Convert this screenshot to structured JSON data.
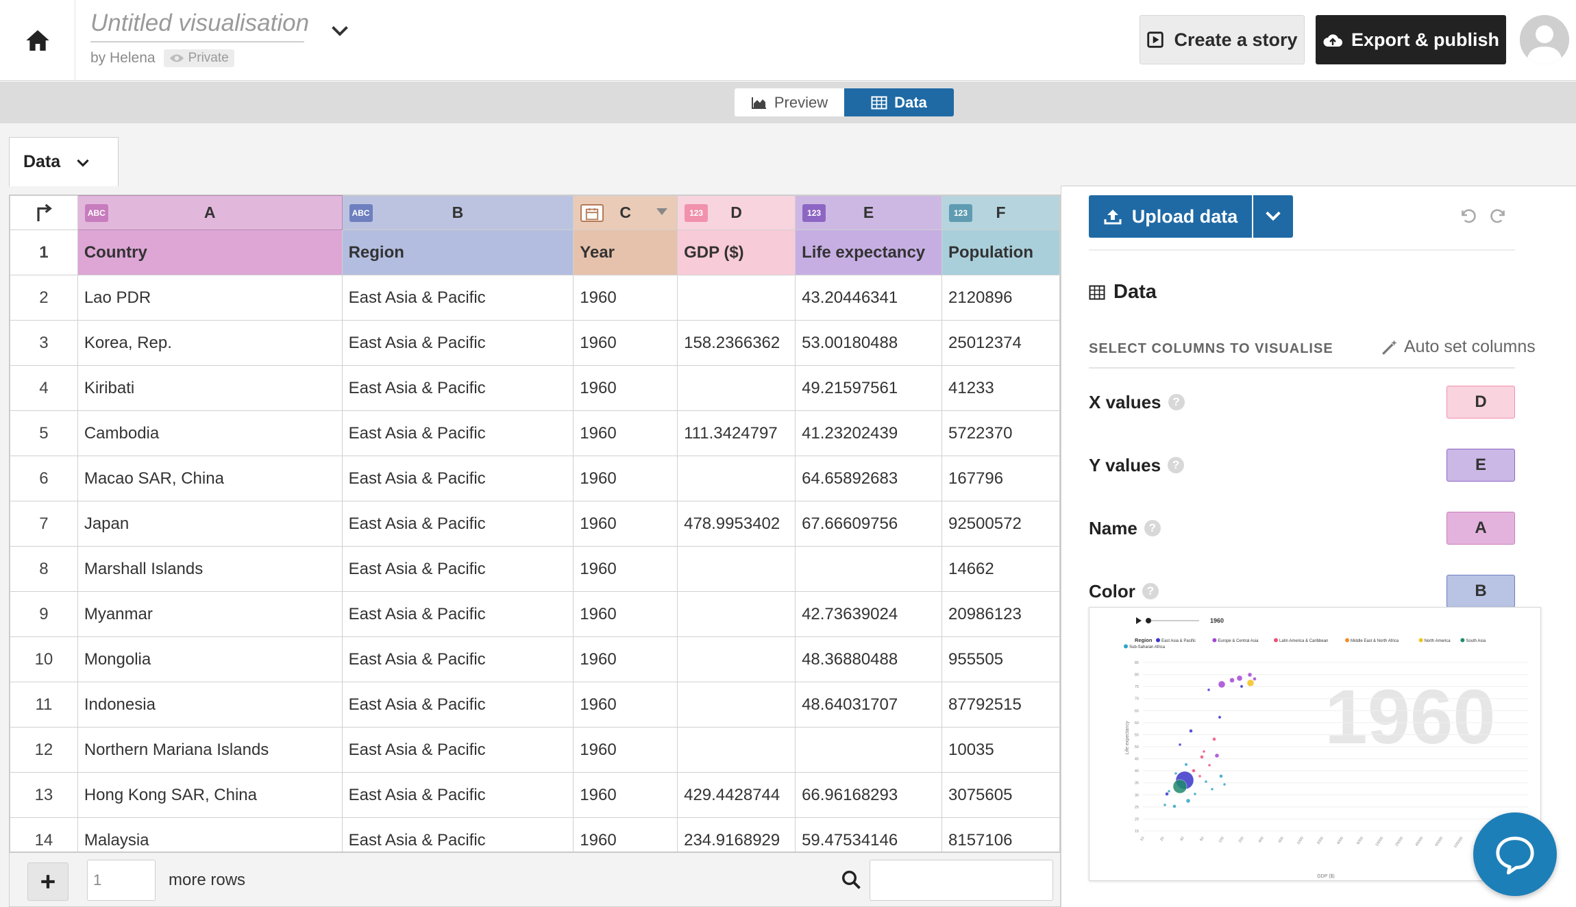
{
  "header": {
    "title": "Untitled visualisation",
    "byline": "by Helena",
    "privacy": "Private",
    "create_story": "Create a story",
    "export_publish": "Export & publish"
  },
  "view_toggle": {
    "preview": "Preview",
    "data": "Data"
  },
  "sheet_tab": {
    "label": "Data"
  },
  "grid": {
    "columns": [
      {
        "letter": "A",
        "type": "ABC",
        "header": "Country"
      },
      {
        "letter": "B",
        "type": "ABC",
        "header": "Region"
      },
      {
        "letter": "C",
        "type": "date",
        "header": "Year"
      },
      {
        "letter": "D",
        "type": "123",
        "header": "GDP ($)"
      },
      {
        "letter": "E",
        "type": "123",
        "header": "Life expectancy"
      },
      {
        "letter": "F",
        "type": "123",
        "header": "Population"
      }
    ],
    "header_row_number": "1",
    "rows": [
      {
        "num": "2",
        "cells": [
          "Lao PDR",
          "East Asia & Pacific",
          "1960",
          "",
          "43.20446341",
          "2120896"
        ]
      },
      {
        "num": "3",
        "cells": [
          "Korea, Rep.",
          "East Asia & Pacific",
          "1960",
          "158.2366362",
          "53.00180488",
          "25012374"
        ]
      },
      {
        "num": "4",
        "cells": [
          "Kiribati",
          "East Asia & Pacific",
          "1960",
          "",
          "49.21597561",
          "41233"
        ]
      },
      {
        "num": "5",
        "cells": [
          "Cambodia",
          "East Asia & Pacific",
          "1960",
          "111.3424797",
          "41.23202439",
          "5722370"
        ]
      },
      {
        "num": "6",
        "cells": [
          "Macao SAR, China",
          "East Asia & Pacific",
          "1960",
          "",
          "64.65892683",
          "167796"
        ]
      },
      {
        "num": "7",
        "cells": [
          "Japan",
          "East Asia & Pacific",
          "1960",
          "478.9953402",
          "67.66609756",
          "92500572"
        ]
      },
      {
        "num": "8",
        "cells": [
          "Marshall Islands",
          "East Asia & Pacific",
          "1960",
          "",
          "",
          "14662"
        ]
      },
      {
        "num": "9",
        "cells": [
          "Myanmar",
          "East Asia & Pacific",
          "1960",
          "",
          "42.73639024",
          "20986123"
        ]
      },
      {
        "num": "10",
        "cells": [
          "Mongolia",
          "East Asia & Pacific",
          "1960",
          "",
          "48.36880488",
          "955505"
        ]
      },
      {
        "num": "11",
        "cells": [
          "Indonesia",
          "East Asia & Pacific",
          "1960",
          "",
          "48.64031707",
          "87792515"
        ]
      },
      {
        "num": "12",
        "cells": [
          "Northern Mariana Islands",
          "East Asia & Pacific",
          "1960",
          "",
          "",
          "10035"
        ]
      },
      {
        "num": "13",
        "cells": [
          "Hong Kong SAR, China",
          "East Asia & Pacific",
          "1960",
          "429.4428744",
          "66.96168293",
          "3075605"
        ]
      },
      {
        "num": "14",
        "cells": [
          "Malaysia",
          "East Asia & Pacific",
          "1960",
          "234.9168929",
          "59.47534146",
          "8157106"
        ]
      }
    ],
    "colors": {
      "A": "#c77dbd",
      "B": "#6d7fbf",
      "C": "#c98e6a",
      "D": "#f191ad",
      "E": "#8d66c4",
      "F": "#5f9cb2"
    }
  },
  "footer": {
    "rows_value": "1",
    "more_rows": "more rows",
    "search_placeholder": ""
  },
  "panel": {
    "upload": "Upload data",
    "heading": "Data",
    "select_label": "SELECT COLUMNS TO VISUALISE",
    "auto_set": "Auto set columns",
    "bindings": [
      {
        "label": "X values",
        "column": "D"
      },
      {
        "label": "Y values",
        "column": "E"
      },
      {
        "label": "Name",
        "column": "A"
      },
      {
        "label": "Color",
        "column": "B"
      }
    ]
  },
  "thumbnail": {
    "timeline_label": "1960",
    "legend_title": "Region",
    "legend_items": [
      {
        "name": "East Asia & Pacific",
        "color": "#3a35c9"
      },
      {
        "name": "Europe & Central Asia",
        "color": "#a446d6"
      },
      {
        "name": "Latin America & Caribbean",
        "color": "#ef4f78"
      },
      {
        "name": "Middle East & North Africa",
        "color": "#f28c2b"
      },
      {
        "name": "North America",
        "color": "#f2c21b"
      },
      {
        "name": "South Asia",
        "color": "#1f8a6f"
      },
      {
        "name": "Sub-Saharan Africa",
        "color": "#2fa3c8"
      }
    ],
    "big_year": "1960",
    "ylabel": "Life expectancy",
    "xlabel": "GDP ($)",
    "y_ticks": [
      "85",
      "80",
      "75",
      "70",
      "65",
      "60",
      "55",
      "50",
      "45",
      "40",
      "35",
      "30",
      "25",
      "20",
      "15"
    ],
    "x_ticks": [
      "10",
      "20",
      "40",
      "60",
      "100",
      "200",
      "400",
      "600",
      "1000",
      "2000",
      "4000",
      "6000",
      "10000",
      "20000",
      "40000",
      "60000",
      "100000",
      "200000",
      "400000",
      "600000"
    ]
  }
}
